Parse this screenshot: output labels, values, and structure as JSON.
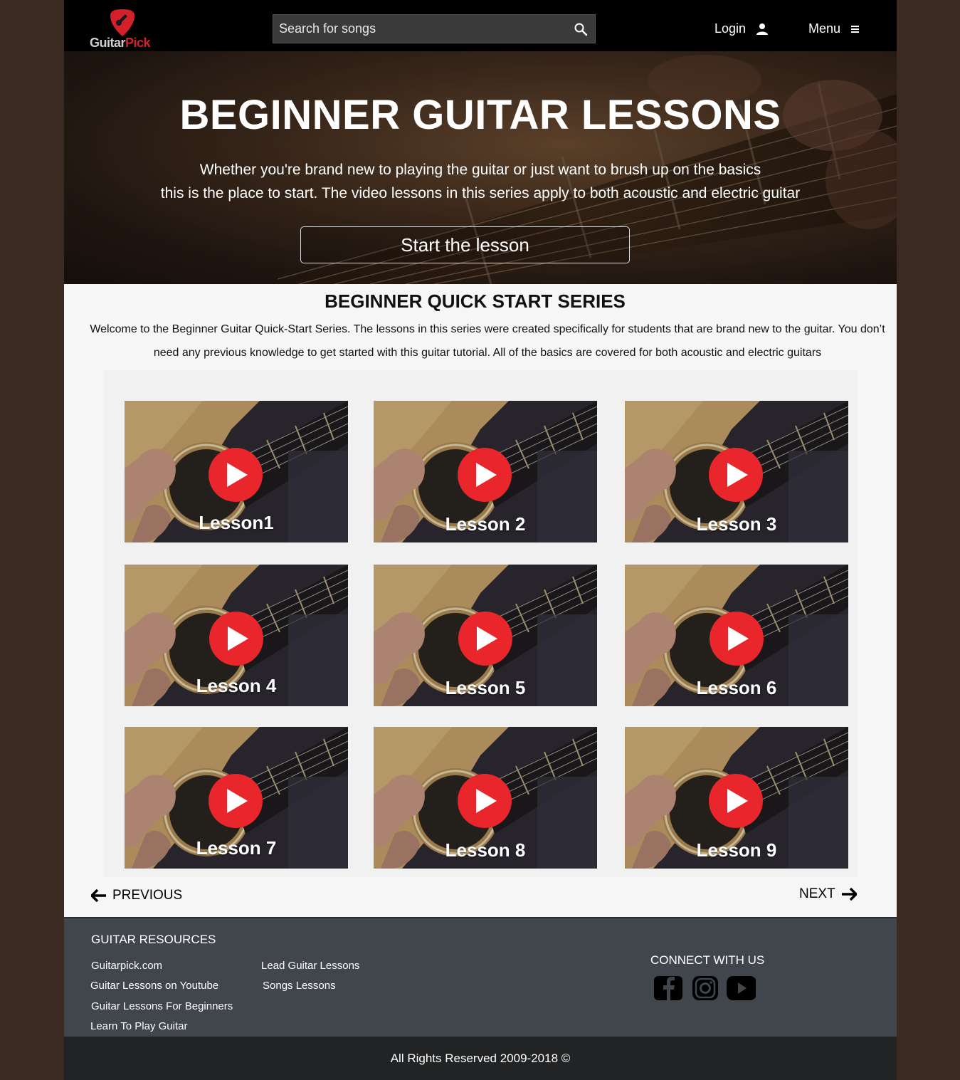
{
  "header": {
    "logo_text_a": "Guitar",
    "logo_text_b": "Pick",
    "search_placeholder": "Search for songs",
    "login_label": "Login",
    "menu_label": "Menu"
  },
  "hero": {
    "title": "BEGINNER GUITAR LESSONS",
    "line1": "Whether you're brand new to playing the guitar or just want to brush up on the basics",
    "line2": "this is the place to start. The video lessons in this series apply to both acoustic and electric guitar",
    "button_label": "Start the lesson"
  },
  "series": {
    "title": "BEGINNER QUICK START SERIES",
    "description": "Welcome to the Beginner Guitar Quick-Start Series. The lessons in this series were created specifically for students that are brand new to the guitar. You don’t need any previous knowledge to get started with this guitar tutorial. All of the basics are covered for both acoustic and electric guitars",
    "lessons": [
      {
        "label": "Lesson1"
      },
      {
        "label": "Lesson 2"
      },
      {
        "label": "Lesson 3"
      },
      {
        "label": "Lesson 4"
      },
      {
        "label": "Lesson 5"
      },
      {
        "label": "Lesson 6"
      },
      {
        "label": "Lesson 7"
      },
      {
        "label": "Lesson 8"
      },
      {
        "label": "Lesson 9"
      }
    ]
  },
  "pager": {
    "previous_label": "PREVIOUS",
    "next_label": "NEXT"
  },
  "footer": {
    "resources_heading": "GUITAR RESOURCES",
    "links": [
      "Guitarpick.com",
      "Guitar Lessons on Youtube",
      "Guitar Lessons For Beginners",
      "Learn To Play Guitar",
      "Lead Guitar Lessons",
      "Songs Lessons"
    ],
    "connect_heading": "CONNECT WITH US",
    "social_icons": [
      "facebook-icon",
      "instagram-icon",
      "youtube-icon"
    ],
    "copyright": "All Rights Reserved  2009-2018 ©"
  },
  "colors": {
    "brand_red": "#d4202a",
    "play_red": "#e8262b",
    "footer_bg": "#40464b",
    "page_bg": "#3b2a22"
  }
}
